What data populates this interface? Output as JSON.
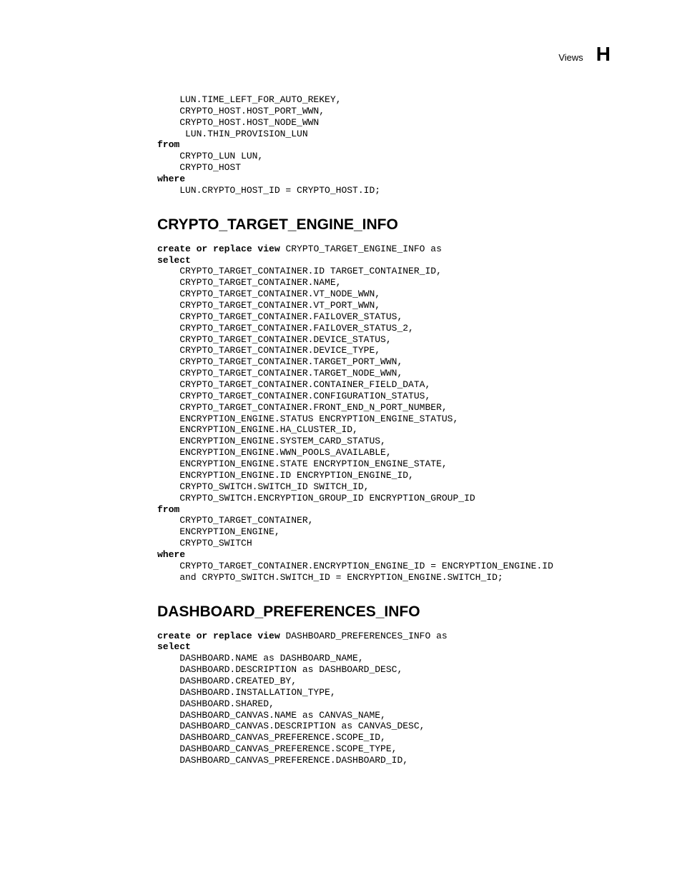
{
  "header": {
    "label": "Views",
    "letter": "H"
  },
  "block1": {
    "lines_a": "    LUN.TIME_LEFT_FOR_AUTO_REKEY,\n    CRYPTO_HOST.HOST_PORT_WWN,\n    CRYPTO_HOST.HOST_NODE_WWN\n     LUN.THIN_PROVISION_LUN",
    "kw_from": "from",
    "lines_b": "    CRYPTO_LUN LUN,\n    CRYPTO_HOST",
    "kw_where": "where",
    "lines_c": "    LUN.CRYPTO_HOST_ID = CRYPTO_HOST.ID;"
  },
  "section1_title": "CRYPTO_TARGET_ENGINE_INFO",
  "block2": {
    "create_pre": "create or replace view ",
    "create_name": "CRYPTO_TARGET_ENGINE_INFO as",
    "kw_select": "select",
    "lines_a": "    CRYPTO_TARGET_CONTAINER.ID TARGET_CONTAINER_ID,\n    CRYPTO_TARGET_CONTAINER.NAME,\n    CRYPTO_TARGET_CONTAINER.VT_NODE_WWN,\n    CRYPTO_TARGET_CONTAINER.VT_PORT_WWN,\n    CRYPTO_TARGET_CONTAINER.FAILOVER_STATUS,\n    CRYPTO_TARGET_CONTAINER.FAILOVER_STATUS_2,\n    CRYPTO_TARGET_CONTAINER.DEVICE_STATUS,\n    CRYPTO_TARGET_CONTAINER.DEVICE_TYPE,\n    CRYPTO_TARGET_CONTAINER.TARGET_PORT_WWN,\n    CRYPTO_TARGET_CONTAINER.TARGET_NODE_WWN,\n    CRYPTO_TARGET_CONTAINER.CONTAINER_FIELD_DATA,\n    CRYPTO_TARGET_CONTAINER.CONFIGURATION_STATUS,\n    CRYPTO_TARGET_CONTAINER.FRONT_END_N_PORT_NUMBER,\n    ENCRYPTION_ENGINE.STATUS ENCRYPTION_ENGINE_STATUS,\n    ENCRYPTION_ENGINE.HA_CLUSTER_ID,\n    ENCRYPTION_ENGINE.SYSTEM_CARD_STATUS,\n    ENCRYPTION_ENGINE.WWN_POOLS_AVAILABLE,\n    ENCRYPTION_ENGINE.STATE ENCRYPTION_ENGINE_STATE,\n    ENCRYPTION_ENGINE.ID ENCRYPTION_ENGINE_ID,\n    CRYPTO_SWITCH.SWITCH_ID SWITCH_ID,\n    CRYPTO_SWITCH.ENCRYPTION_GROUP_ID ENCRYPTION_GROUP_ID",
    "kw_from": "from",
    "lines_b": "    CRYPTO_TARGET_CONTAINER,\n    ENCRYPTION_ENGINE,\n    CRYPTO_SWITCH",
    "kw_where": "where",
    "lines_c": "    CRYPTO_TARGET_CONTAINER.ENCRYPTION_ENGINE_ID = ENCRYPTION_ENGINE.ID\n    and CRYPTO_SWITCH.SWITCH_ID = ENCRYPTION_ENGINE.SWITCH_ID;"
  },
  "section2_title": "DASHBOARD_PREFERENCES_INFO",
  "block3": {
    "create_pre": "create or replace view ",
    "create_name": "DASHBOARD_PREFERENCES_INFO as",
    "kw_select": "select",
    "lines_a": "    DASHBOARD.NAME as DASHBOARD_NAME,\n    DASHBOARD.DESCRIPTION as DASHBOARD_DESC,\n    DASHBOARD.CREATED_BY,\n    DASHBOARD.INSTALLATION_TYPE,\n    DASHBOARD.SHARED,\n    DASHBOARD_CANVAS.NAME as CANVAS_NAME,\n    DASHBOARD_CANVAS.DESCRIPTION as CANVAS_DESC,\n    DASHBOARD_CANVAS_PREFERENCE.SCOPE_ID,\n    DASHBOARD_CANVAS_PREFERENCE.SCOPE_TYPE,\n    DASHBOARD_CANVAS_PREFERENCE.DASHBOARD_ID,"
  }
}
